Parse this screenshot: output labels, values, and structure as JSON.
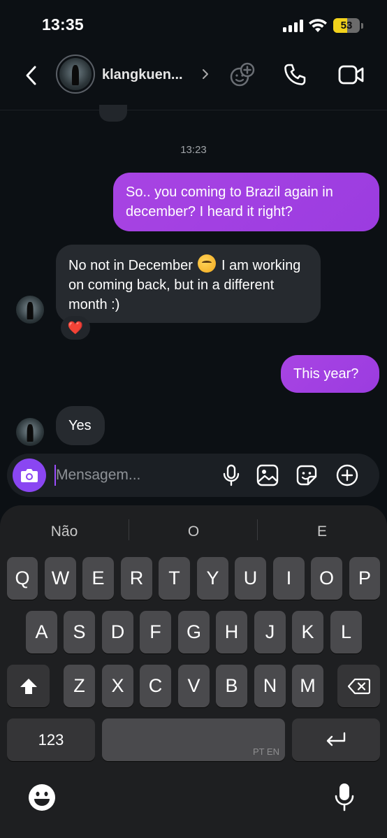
{
  "status_bar": {
    "time": "13:35",
    "battery": "53",
    "battery_fraction": 0.53
  },
  "header": {
    "username": "klangkuen..."
  },
  "chat": {
    "timestamp": "13:23",
    "messages": [
      {
        "direction": "outgoing",
        "text": "So.. you coming to Brazil again in december? I heard it right?"
      },
      {
        "direction": "incoming",
        "text_before_emoji": "No not in December",
        "emoji": "thinking-face",
        "text_after_emoji": " I am working on coming back, but in a different month :)",
        "reaction": "❤️"
      },
      {
        "direction": "outgoing",
        "text": "This year?"
      },
      {
        "direction": "incoming",
        "text": "Yes"
      }
    ]
  },
  "composer": {
    "placeholder": "Mensagem..."
  },
  "keyboard": {
    "suggestions": [
      "Não",
      "O",
      "E"
    ],
    "row1": [
      "Q",
      "W",
      "E",
      "R",
      "T",
      "Y",
      "U",
      "I",
      "O",
      "P"
    ],
    "row2": [
      "A",
      "S",
      "D",
      "F",
      "G",
      "H",
      "J",
      "K",
      "L"
    ],
    "row3": [
      "Z",
      "X",
      "C",
      "V",
      "B",
      "N",
      "M"
    ],
    "numbers_label": "123",
    "space_hint": "PT EN"
  },
  "colors": {
    "accent": "#9b3ce0",
    "camera_button": "#8a46f2",
    "heart": "#ff2a3f",
    "battery": "#f2d21b"
  }
}
